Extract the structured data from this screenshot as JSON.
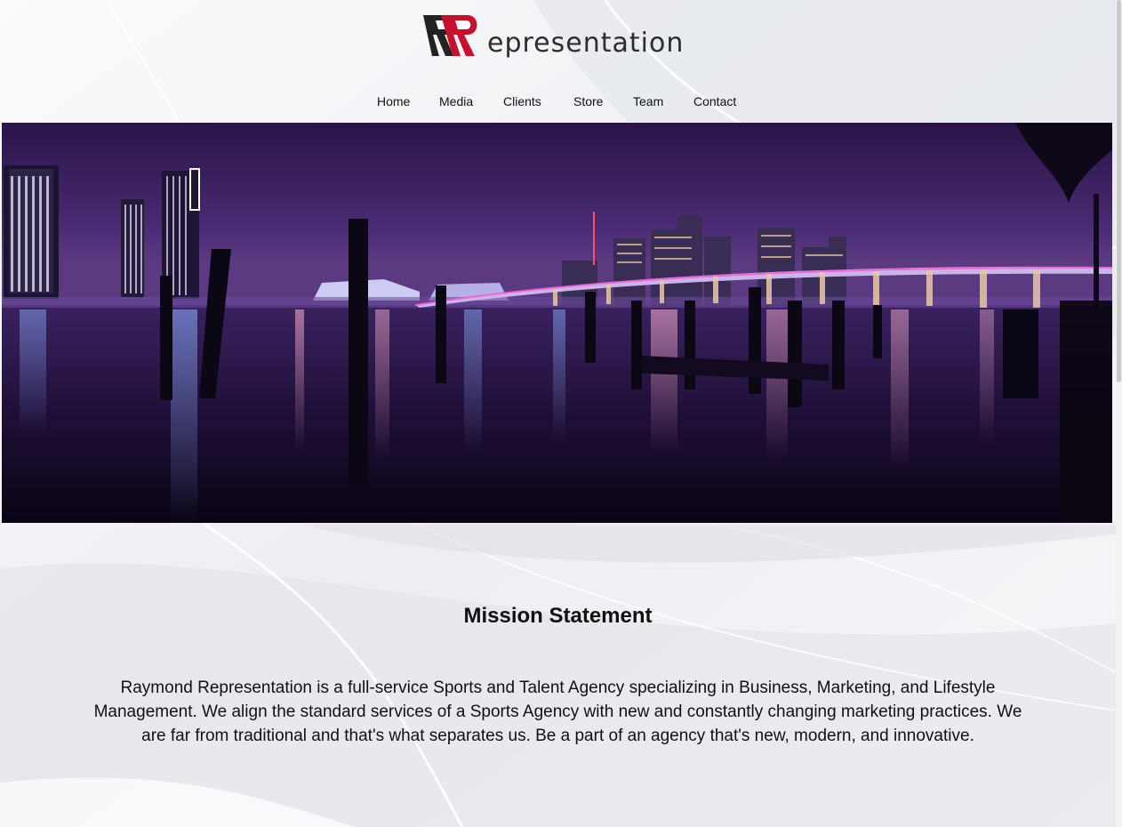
{
  "brand": {
    "logo_letters": "RR",
    "name_text": "epresentation"
  },
  "nav": {
    "items": [
      {
        "label": "Home"
      },
      {
        "label": "Media"
      },
      {
        "label": "Clients"
      },
      {
        "label": "Store"
      },
      {
        "label": "Team"
      },
      {
        "label": "Contact"
      }
    ]
  },
  "hero": {
    "icon": "city-skyline-night-photo"
  },
  "mission": {
    "title": "Mission Statement",
    "body": "Raymond Representation is a full-service Sports and Talent Agency specializing in Business, Marketing, and Lifestyle Management. We align the standard services of a Sports Agency with new and constantly changing marketing practices. We are far from traditional and that's what separates us. Be a part of an agency that's new, modern, and innovative."
  },
  "colors": {
    "logo_red": "#c8102e",
    "logo_dark": "#222222",
    "sky_top": "#3a1f5c",
    "water": "#1a0a2e"
  }
}
